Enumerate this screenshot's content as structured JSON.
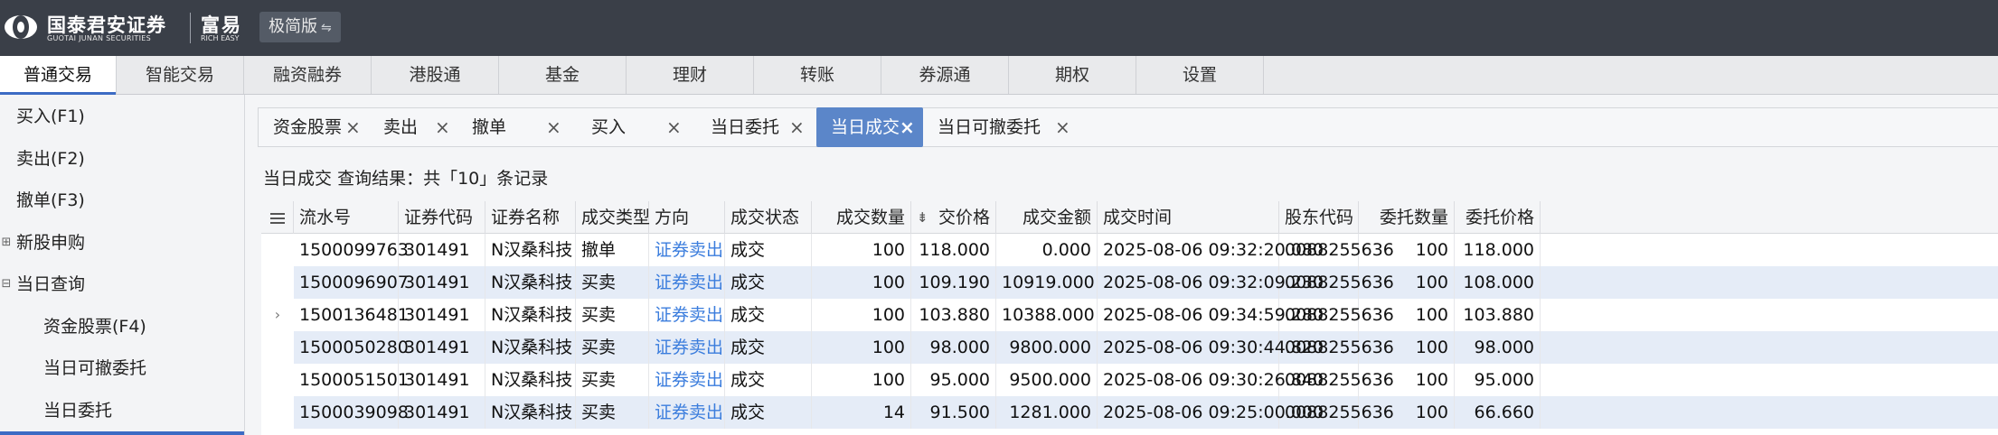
{
  "brand": {
    "name_cn": "国泰君安证券",
    "name_en": "GUOTAI JUNAN SECURITIES",
    "product_cn": "富易",
    "product_en": "RICH EASY",
    "edition_label": "极简版",
    "edition_switch_icon": "swap-icon"
  },
  "colors": {
    "titlebar": "#3a3f48",
    "accent": "#3c6bc4",
    "active_tab": "#5b86c9",
    "row_alt": "#e5ecf7",
    "link": "#3b7ddd"
  },
  "topnav": [
    "普通交易",
    "智能交易",
    "融资融券",
    "港股通",
    "基金",
    "理财",
    "转账",
    "券源通",
    "期权",
    "设置"
  ],
  "sidebar": [
    {
      "label": "买入(F1)",
      "indent": 0,
      "toggle": ""
    },
    {
      "label": "卖出(F2)",
      "indent": 0,
      "toggle": ""
    },
    {
      "label": "撤单(F3)",
      "indent": 0,
      "toggle": ""
    },
    {
      "label": "新股申购",
      "indent": 0,
      "toggle": "⊞"
    },
    {
      "label": "当日查询",
      "indent": 0,
      "toggle": "⊟"
    },
    {
      "label": "资金股票(F4)",
      "indent": 1,
      "toggle": ""
    },
    {
      "label": "当日可撤委托",
      "indent": 1,
      "toggle": ""
    },
    {
      "label": "当日委托",
      "indent": 1,
      "toggle": ""
    }
  ],
  "tabs": [
    {
      "label": "资金股票",
      "active": false
    },
    {
      "label": "卖出",
      "active": false
    },
    {
      "label": "撤单",
      "active": false
    },
    {
      "label": "买入",
      "active": false
    },
    {
      "label": "当日委托",
      "active": false
    },
    {
      "label": "当日成交",
      "active": true
    },
    {
      "label": "当日可撤委托",
      "active": false
    }
  ],
  "tab_close": "×",
  "result": {
    "prefix": "当日成交",
    "text": "查询结果：共「10」条记录"
  },
  "table": {
    "menu_icon": "list-menu-icon",
    "sort_icon": "sort-desc-icon",
    "columns": [
      {
        "key": "serial",
        "label": "流水号",
        "align": "left"
      },
      {
        "key": "code",
        "label": "证券代码",
        "align": "left"
      },
      {
        "key": "name",
        "label": "证券名称",
        "align": "left"
      },
      {
        "key": "type",
        "label": "成交类型",
        "align": "left"
      },
      {
        "key": "direction",
        "label": "方向",
        "align": "left"
      },
      {
        "key": "status",
        "label": "成交状态",
        "align": "left"
      },
      {
        "key": "qty",
        "label": "成交数量",
        "align": "right"
      },
      {
        "key": "price",
        "label": "交价格",
        "align": "right"
      },
      {
        "key": "amount",
        "label": "成交金额",
        "align": "right"
      },
      {
        "key": "time",
        "label": "成交时间",
        "align": "left"
      },
      {
        "key": "holder",
        "label": "股东代码",
        "align": "left"
      },
      {
        "key": "order_qty",
        "label": "委托数量",
        "align": "right"
      },
      {
        "key": "order_price",
        "label": "委托价格",
        "align": "right"
      }
    ],
    "rows": [
      {
        "serial": "1500099763",
        "code": "301491",
        "name": "N汉桑科技",
        "type": "撤单",
        "direction": "证券卖出",
        "status": "成交",
        "qty": "100",
        "price": "118.000",
        "amount": "0.000",
        "time": "2025-08-06 09:32:20.080",
        "holder": "0088255636",
        "order_qty": "100",
        "order_price": "118.000",
        "marker": ""
      },
      {
        "serial": "1500096907",
        "code": "301491",
        "name": "N汉桑科技",
        "type": "买卖",
        "direction": "证券卖出",
        "status": "成交",
        "qty": "100",
        "price": "109.190",
        "amount": "10919.000",
        "time": "2025-08-06 09:32:09.230",
        "holder": "0088255636",
        "order_qty": "100",
        "order_price": "108.000",
        "marker": ""
      },
      {
        "serial": "1500136481",
        "code": "301491",
        "name": "N汉桑科技",
        "type": "买卖",
        "direction": "证券卖出",
        "status": "成交",
        "qty": "100",
        "price": "103.880",
        "amount": "10388.000",
        "time": "2025-08-06 09:34:59.280",
        "holder": "0088255636",
        "order_qty": "100",
        "order_price": "103.880",
        "marker": "›"
      },
      {
        "serial": "1500050280",
        "code": "301491",
        "name": "N汉桑科技",
        "type": "买卖",
        "direction": "证券卖出",
        "status": "成交",
        "qty": "100",
        "price": "98.000",
        "amount": "9800.000",
        "time": "2025-08-06 09:30:44.820",
        "holder": "0088255636",
        "order_qty": "100",
        "order_price": "98.000",
        "marker": ""
      },
      {
        "serial": "1500051501",
        "code": "301491",
        "name": "N汉桑科技",
        "type": "买卖",
        "direction": "证券卖出",
        "status": "成交",
        "qty": "100",
        "price": "95.000",
        "amount": "9500.000",
        "time": "2025-08-06 09:30:26.840",
        "holder": "0088255636",
        "order_qty": "100",
        "order_price": "95.000",
        "marker": ""
      },
      {
        "serial": "1500039098",
        "code": "301491",
        "name": "N汉桑科技",
        "type": "买卖",
        "direction": "证券卖出",
        "status": "成交",
        "qty": "14",
        "price": "91.500",
        "amount": "1281.000",
        "time": "2025-08-06 09:25:00.000",
        "holder": "0088255636",
        "order_qty": "100",
        "order_price": "66.660",
        "marker": ""
      }
    ]
  }
}
